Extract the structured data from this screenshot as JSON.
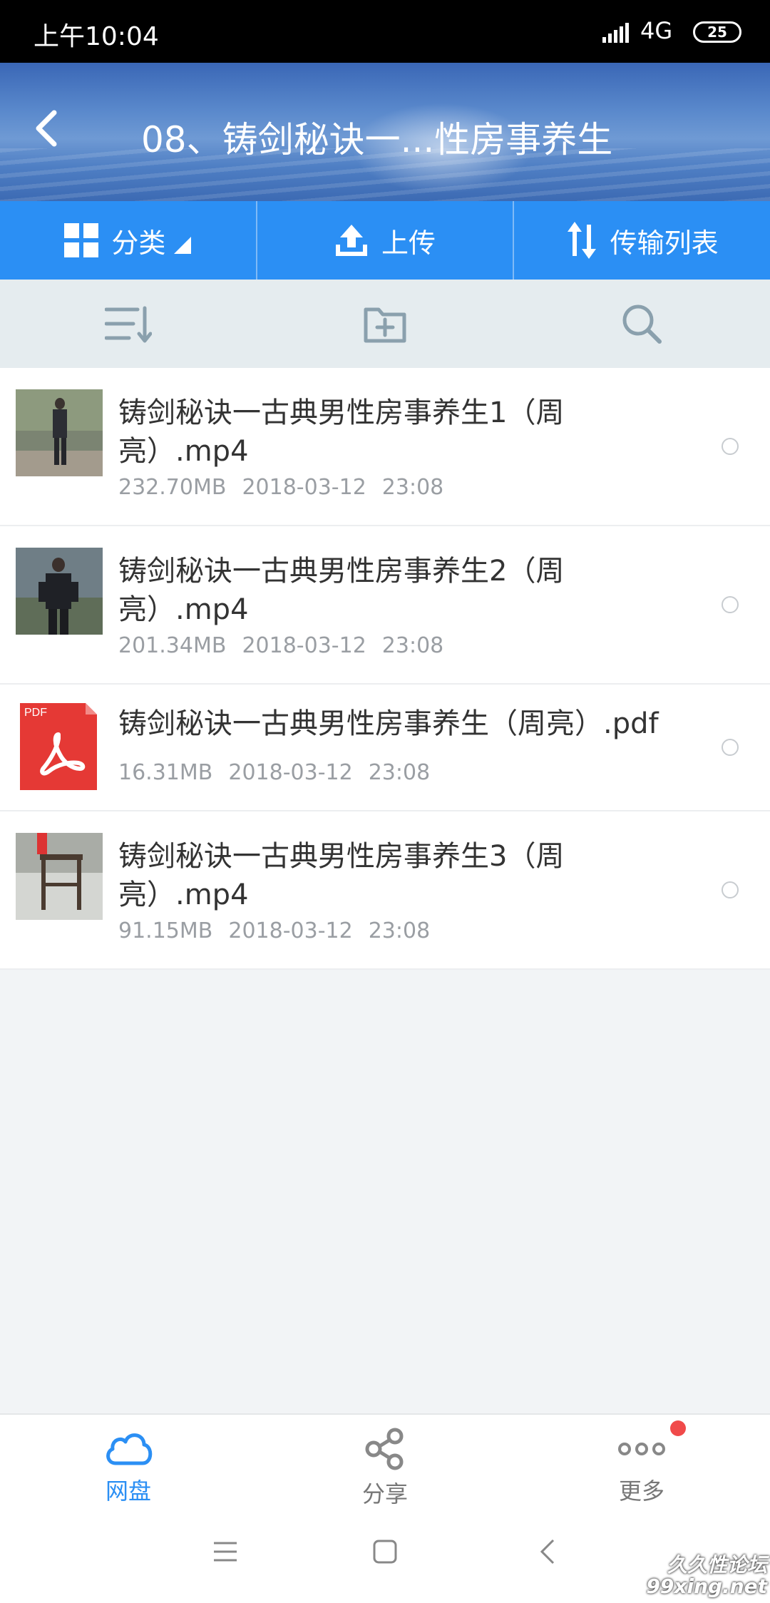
{
  "status_bar": {
    "time": "上午10:04",
    "network": "4G",
    "battery": "25"
  },
  "header": {
    "title": "08、铸剑秘诀一...性房事养生"
  },
  "toolbar": {
    "category_label": "分类",
    "upload_label": "上传",
    "transfer_label": "传输列表"
  },
  "files": [
    {
      "name": "铸剑秘诀一古典男性房事养生1（周亮）.mp4",
      "size": "232.70MB",
      "date": "2018-03-12",
      "time": "23:08",
      "type": "video"
    },
    {
      "name": "铸剑秘诀一古典男性房事养生2（周亮）.mp4",
      "size": "201.34MB",
      "date": "2018-03-12",
      "time": "23:08",
      "type": "video"
    },
    {
      "name": "铸剑秘诀一古典男性房事养生（周亮）.pdf",
      "size": "16.31MB",
      "date": "2018-03-12",
      "time": "23:08",
      "type": "pdf",
      "badge": "PDF"
    },
    {
      "name": "铸剑秘诀一古典男性房事养生3（周亮）.mp4",
      "size": "91.15MB",
      "date": "2018-03-12",
      "time": "23:08",
      "type": "video"
    }
  ],
  "tabs": [
    {
      "label": "网盘",
      "icon": "cloud-icon",
      "active": true
    },
    {
      "label": "分享",
      "icon": "share-icon",
      "active": false
    },
    {
      "label": "更多",
      "icon": "more-icon",
      "active": false
    }
  ],
  "watermark": {
    "line1": "久久性论坛",
    "line2": "99xing.net"
  },
  "colors": {
    "accent": "#2b8ff4",
    "badge": "#f04a4a",
    "pdf": "#e53935"
  }
}
